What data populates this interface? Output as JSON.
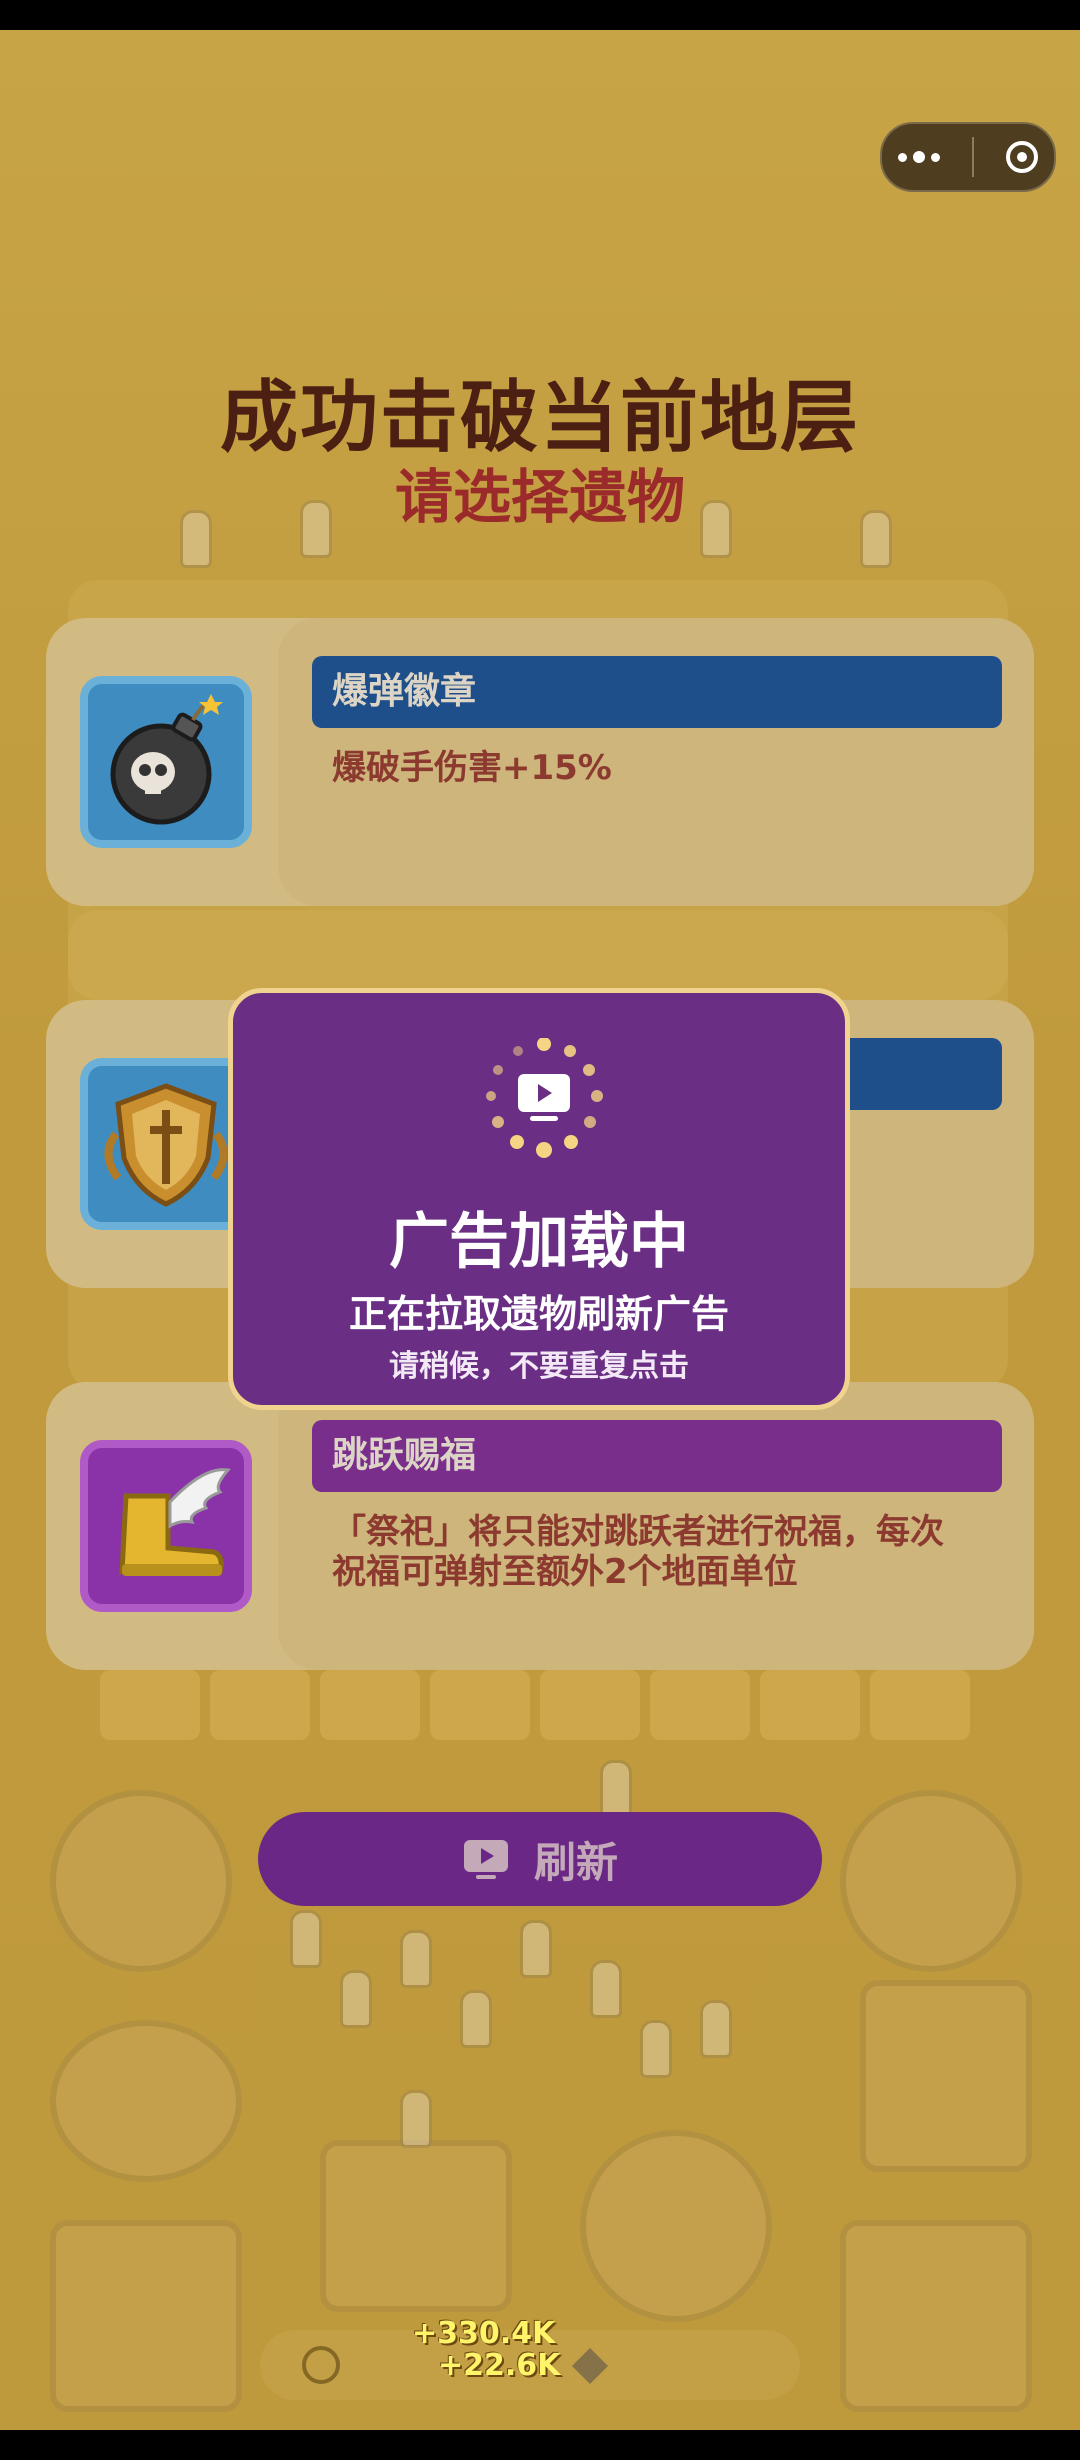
{
  "header": {
    "title": "成功击破当前地层",
    "subtitle": "请选择遗物"
  },
  "relics": [
    {
      "name": "爆弹徽章",
      "desc": "爆破手伤害+15%",
      "color": "blue",
      "icon": "bomb-icon"
    },
    {
      "name": "",
      "desc": "",
      "color": "blue",
      "icon": "shield-icon"
    },
    {
      "name": "跳跃赐福",
      "desc": "「祭祀」将只能对跳跃者进行祝福，每次祝福可弹射至额外2个地面单位",
      "color": "purple",
      "icon": "winged-boot-icon"
    }
  ],
  "modal": {
    "title": "广告加载中",
    "subtitle": "正在拉取遗物刷新广告",
    "hint": "请稍候，不要重复点击",
    "icon": "tv-play-icon"
  },
  "refresh": {
    "label": "刷新",
    "icon": "tv-play-icon"
  },
  "floating_numbers": [
    "+330.4K",
    "+22.6K"
  ],
  "colors": {
    "background": "#c09a3c",
    "title": "#4b1f12",
    "subtitle": "#9b2a2a",
    "modal": "#6a2f84",
    "modal_border": "#f0d38e",
    "refresh_button": "#6a2786"
  }
}
